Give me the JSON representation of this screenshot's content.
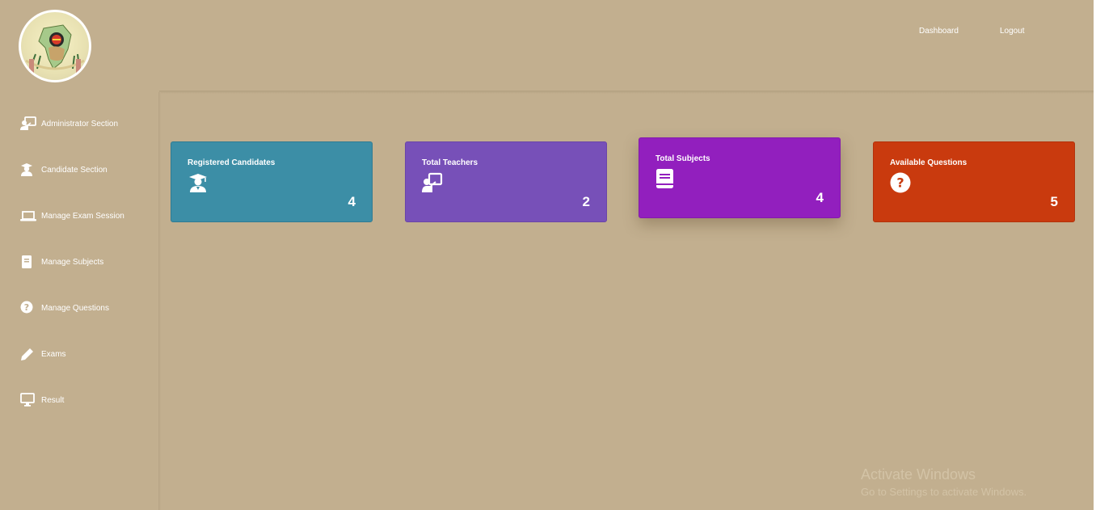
{
  "header": {
    "nav": {
      "dashboard": "Dashboard",
      "logout": "Logout"
    }
  },
  "sidebar": {
    "items": [
      {
        "label": "Administrator Section",
        "icon": "teacher-board-icon"
      },
      {
        "label": "Candidate Section",
        "icon": "graduate-icon"
      },
      {
        "label": "Manage Exam Session",
        "icon": "laptop-icon"
      },
      {
        "label": "Manage Subjects",
        "icon": "book-icon"
      },
      {
        "label": "Manage Questions",
        "icon": "question-circle-icon"
      },
      {
        "label": "Exams",
        "icon": "pencil-icon"
      },
      {
        "label": "Result",
        "icon": "monitor-icon"
      }
    ]
  },
  "cards": [
    {
      "title": "Registered Candidates",
      "count": "4",
      "icon": "graduate-icon",
      "color": "#3c8ea6"
    },
    {
      "title": "Total Teachers",
      "count": "2",
      "icon": "teacher-board-icon",
      "color": "#7750b8"
    },
    {
      "title": "Total Subjects",
      "count": "4",
      "icon": "book-icon",
      "color": "#921fbe"
    },
    {
      "title": "Available Questions",
      "count": "5",
      "icon": "question-circle-icon",
      "color": "#c93a0e"
    }
  ],
  "watermark": {
    "line1": "Activate Windows",
    "line2": "Go to Settings to activate Windows."
  },
  "colors": {
    "background": "#c2af8f"
  }
}
